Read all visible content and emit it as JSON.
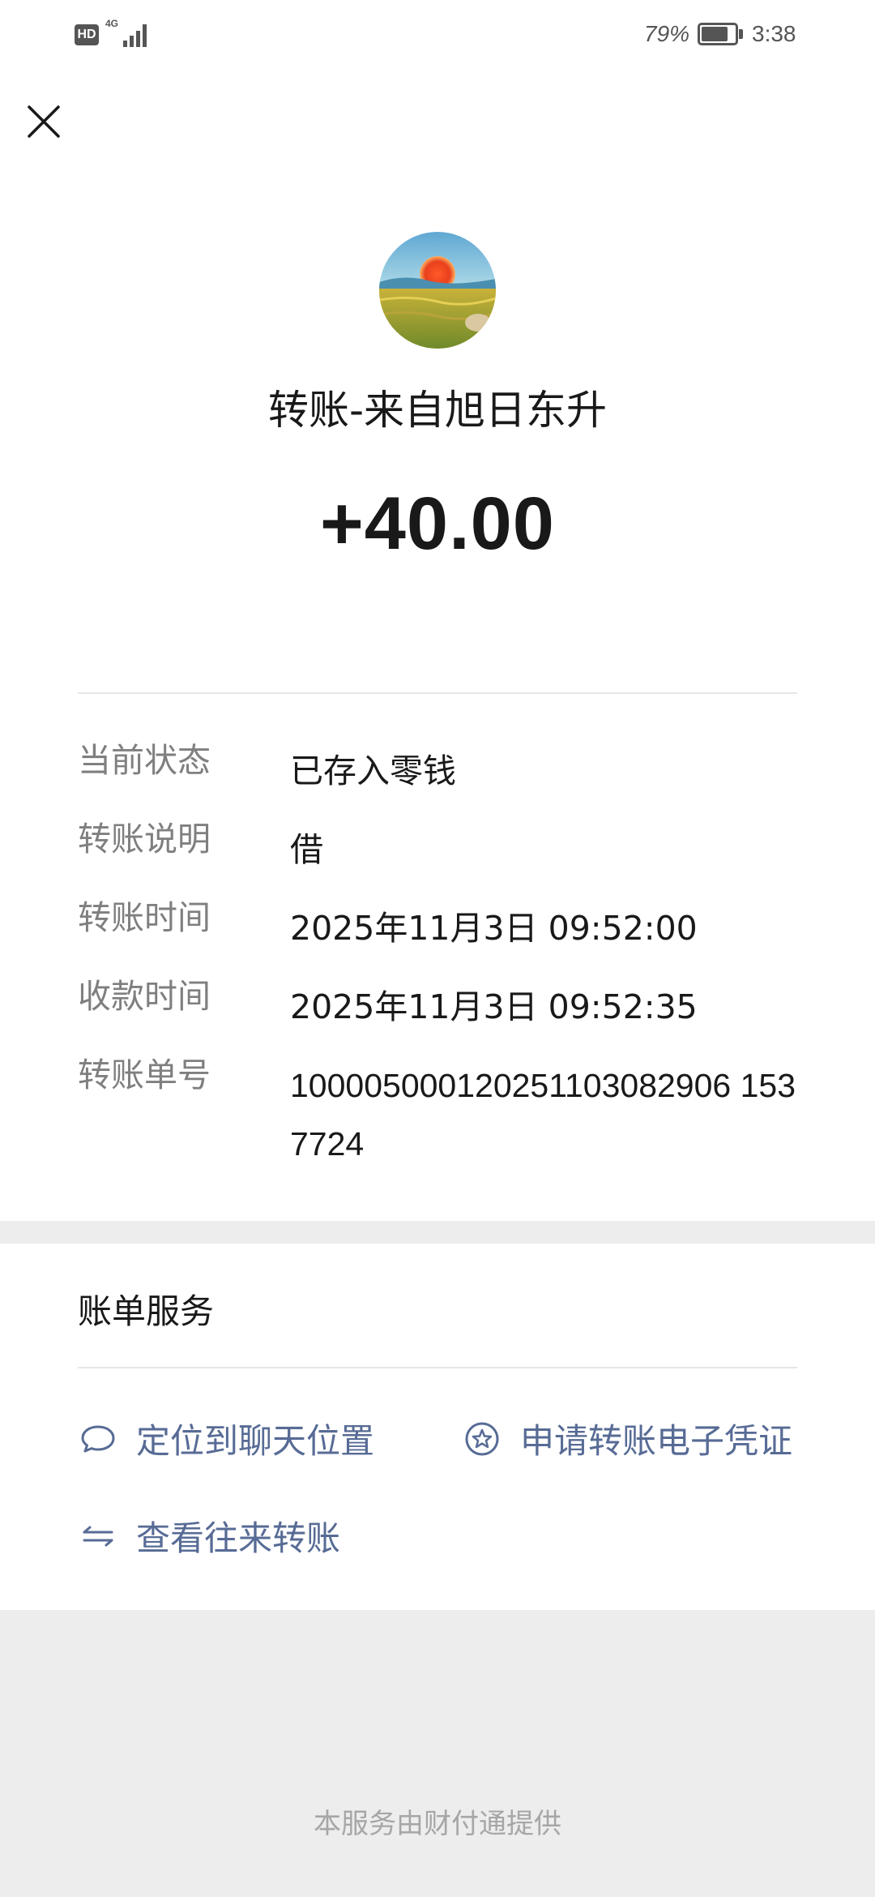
{
  "status_bar": {
    "hd": "HD",
    "network": "4G",
    "battery_percent": "79%",
    "battery_level": 0.79,
    "time": "3:38"
  },
  "nav": {
    "close_icon": "close-icon"
  },
  "transfer": {
    "title": "转账-来自旭日东升",
    "amount": "+40.00"
  },
  "details": [
    {
      "label": "当前状态",
      "value": "已存入零钱"
    },
    {
      "label": "转账说明",
      "value": "借"
    },
    {
      "label": "转账时间",
      "value": "2025年11月3日 09:52:00"
    },
    {
      "label": "收款时间",
      "value": "2025年11月3日 09:52:35"
    },
    {
      "label": "转账单号",
      "value": "100005000120251103082906 1537724"
    }
  ],
  "services": {
    "title": "账单服务",
    "locate_chat": "定位到聊天位置",
    "apply_voucher": "申请转账电子凭证",
    "view_history": "查看往来转账"
  },
  "footer": "本服务由财付通提供",
  "colors": {
    "link": "#576b95",
    "label": "#7f7f7f",
    "text": "#191919",
    "background": "#ededed"
  }
}
